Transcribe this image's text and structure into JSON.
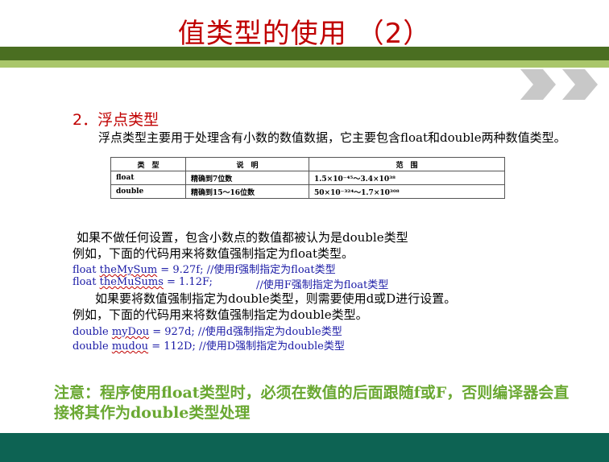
{
  "slide": {
    "title": "值类型的使用 （2）",
    "section_heading": "2．浮点类型",
    "intro": "浮点类型主要用于处理含有小数的数值数据，它主要包含float和double两种数值类型。",
    "table": {
      "headers": [
        "类　型",
        "说　明",
        "范　围"
      ],
      "rows": [
        [
          "float",
          "精确到7位数",
          "1.5×10⁻⁴⁵～3.4×10³⁸"
        ],
        [
          "double",
          "精确到15～16位数",
          "50×10⁻³²⁴～1.7×10³⁰⁸"
        ]
      ]
    },
    "line1": "如果不做任何设置，包含小数点的数值都被认为是double类型",
    "line2": "例如，下面的代码用来将数值强制指定为float类型。",
    "code1": {
      "pre": "float ",
      "var": "theMySum",
      "post": " = 9.27f;  //使用f强制指定为float类型"
    },
    "code2": {
      "pre": "float ",
      "var": "theMuSums",
      "post": " = 1.12F;",
      "comment": "//使用F强制指定为float类型"
    },
    "line3": "如果要将数值强制指定为double类型，则需要使用d或D进行设置。",
    "line4": "例如，下面的代码用来将数值强制指定为double类型。",
    "code3": {
      "pre": "double ",
      "var": "myDou",
      "post": " = 927d;   //使用d强制指定为double类型"
    },
    "code4": {
      "pre": "double ",
      "var": "mudou",
      "post": " = 112D;   //使用D强制指定为double类型"
    },
    "note": "注意：程序使用float类型时，必须在数值的后面跟随f或F，否则编译器会直接将其作为double类型处理"
  },
  "colors": {
    "title": "#c00000",
    "band_dark": "#4a6e21",
    "band_light": "#a9c66a",
    "code": "#1a1aa6",
    "note": "#6aa832",
    "footer": "#0d6353"
  }
}
